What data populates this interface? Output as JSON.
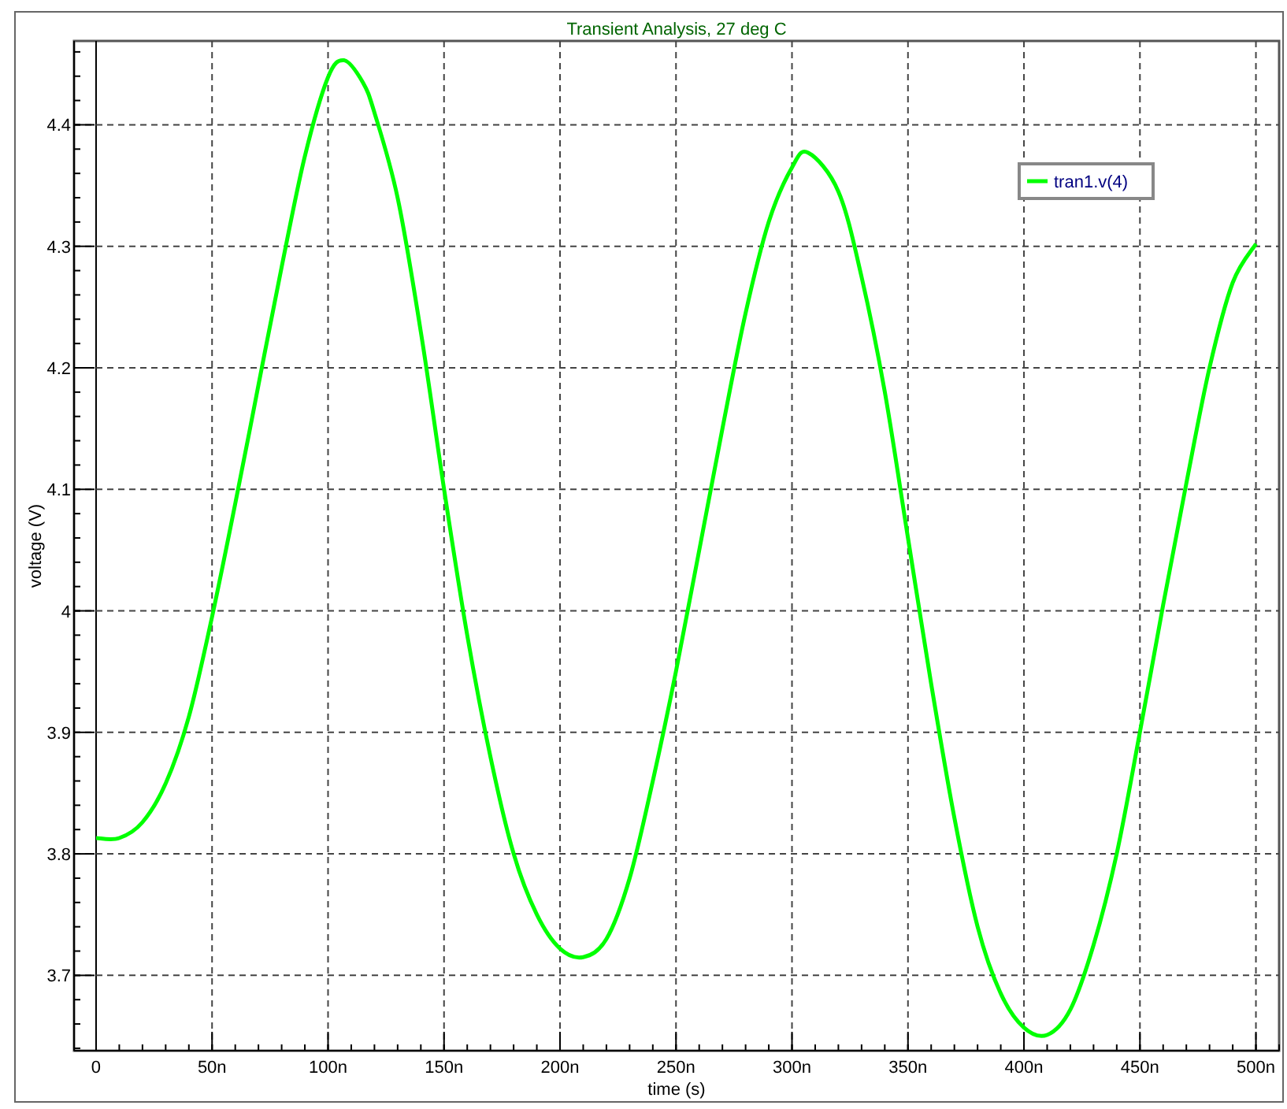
{
  "chart_data": {
    "type": "line",
    "title": "Transient Analysis, 27 deg C",
    "xlabel": "time (s)",
    "ylabel": "voltage (V)",
    "x": [
      0,
      10,
      20,
      30,
      40,
      50,
      60,
      70,
      80,
      90,
      100,
      107,
      115,
      120,
      130,
      140,
      150,
      160,
      170,
      180,
      190,
      200,
      210,
      220,
      230,
      240,
      250,
      260,
      270,
      280,
      290,
      300,
      307,
      320,
      330,
      340,
      350,
      360,
      370,
      380,
      390,
      400,
      410,
      420,
      430,
      440,
      450,
      460,
      470,
      480,
      490,
      500
    ],
    "series": [
      {
        "name": "tran1.v(4)",
        "color": "#00ff00",
        "values": [
          3.813,
          3.813,
          3.826,
          3.858,
          3.913,
          3.995,
          4.088,
          4.186,
          4.283,
          4.374,
          4.439,
          4.453,
          4.435,
          4.41,
          4.34,
          4.23,
          4.1,
          3.98,
          3.88,
          3.8,
          3.75,
          3.722,
          3.715,
          3.73,
          3.78,
          3.86,
          3.95,
          4.05,
          4.15,
          4.245,
          4.32,
          4.365,
          4.377,
          4.345,
          4.275,
          4.18,
          4.06,
          3.94,
          3.83,
          3.74,
          3.685,
          3.657,
          3.651,
          3.672,
          3.725,
          3.8,
          3.9,
          4.005,
          4.105,
          4.2,
          4.27,
          4.302
        ]
      }
    ],
    "xlim": [
      -9.5,
      510
    ],
    "ylim": [
      3.638,
      4.469
    ],
    "xticks": [
      {
        "value": 0,
        "label": "0"
      },
      {
        "value": 50,
        "label": "50n"
      },
      {
        "value": 100,
        "label": "100n"
      },
      {
        "value": 150,
        "label": "150n"
      },
      {
        "value": 200,
        "label": "200n"
      },
      {
        "value": 250,
        "label": "250n"
      },
      {
        "value": 300,
        "label": "300n"
      },
      {
        "value": 350,
        "label": "350n"
      },
      {
        "value": 400,
        "label": "400n"
      },
      {
        "value": 450,
        "label": "450n"
      },
      {
        "value": 500,
        "label": "500n"
      }
    ],
    "yticks": [
      3.7,
      3.8,
      3.9,
      4,
      4.1,
      4.2,
      4.3,
      4.4
    ],
    "grid": true
  }
}
